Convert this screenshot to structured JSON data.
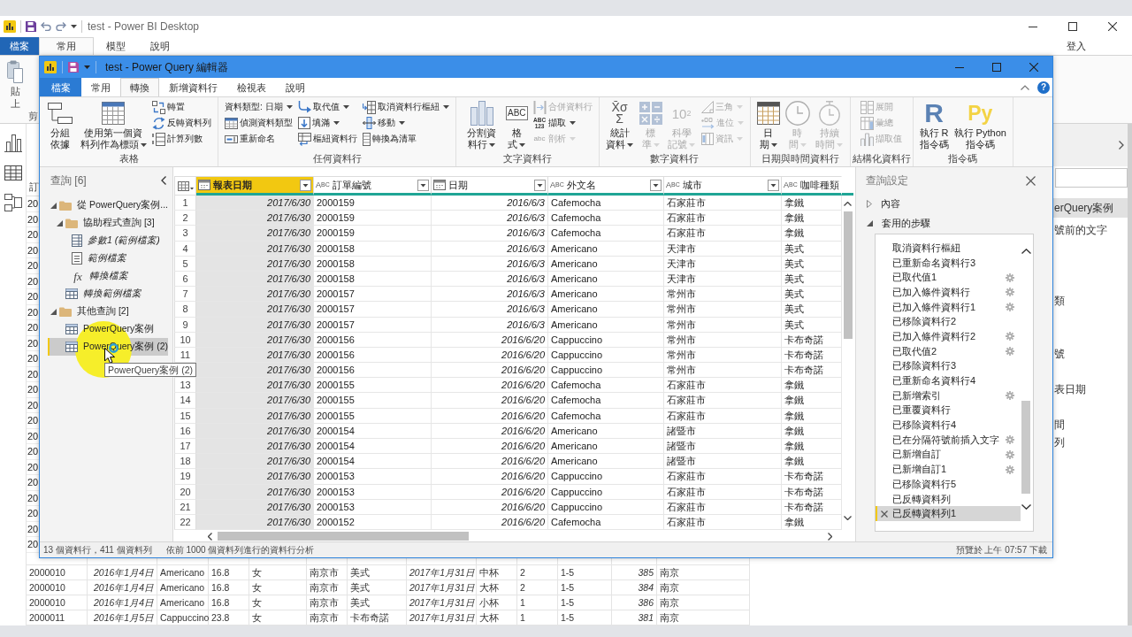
{
  "power_bi": {
    "title": "test - Power BI Desktop",
    "tabs": [
      {
        "label": "檔案",
        "kind": "file",
        "selected": false
      },
      {
        "label": "常用",
        "kind": "tab",
        "selected": true
      },
      {
        "label": "模型",
        "kind": "tab",
        "selected": false
      },
      {
        "label": "說明",
        "kind": "tab",
        "selected": false
      }
    ],
    "sign_in": "登入",
    "ribbon": {
      "paste": "貼上",
      "group_label": "剪"
    },
    "table": {
      "header_cell": "訂",
      "first_column_cells": [
        "20",
        "20",
        "20",
        "20",
        "20",
        "20",
        "20",
        "20",
        "20",
        "20",
        "20",
        "20",
        "20",
        "20",
        "20",
        "20",
        "20",
        "20",
        "20",
        "20",
        "20",
        "20",
        "20"
      ],
      "rows": [
        [
          "2000010",
          "2016年1月4日",
          "Americano",
          "16.8",
          "女",
          "南京市",
          "美式",
          "2017年1月31日",
          "中杯",
          "2",
          "1-5",
          "385",
          "南京"
        ],
        [
          "2000010",
          "2016年1月4日",
          "Americano",
          "16.8",
          "女",
          "南京市",
          "美式",
          "2017年1月31日",
          "大杯",
          "2",
          "1-5",
          "384",
          "南京"
        ],
        [
          "2000010",
          "2016年1月4日",
          "Americano",
          "16.8",
          "女",
          "南京市",
          "美式",
          "2017年1月31日",
          "小杯",
          "1",
          "1-5",
          "386",
          "南京"
        ],
        [
          "2000011",
          "2016年1月5日",
          "Cappuccino",
          "23.8",
          "女",
          "南京市",
          "卡布奇諾",
          "2017年1月31日",
          "大杯",
          "1",
          "1-5",
          "381",
          "南京"
        ]
      ]
    },
    "fields_pane": {
      "items": [
        {
          "label": "erQuery案例",
          "selected": true
        },
        {
          "label": "號前的文字",
          "selected": false
        },
        {
          "label": "類",
          "selected": false
        },
        {
          "label": "號",
          "selected": false
        },
        {
          "label": "表日期",
          "selected": false
        },
        {
          "label": "間",
          "selected": false
        },
        {
          "label": "列",
          "selected": false
        }
      ]
    }
  },
  "query_editor": {
    "title": "test - Power Query 編輯器",
    "tabs": [
      {
        "label": "檔案",
        "kind": "file",
        "selected": false
      },
      {
        "label": "常用",
        "kind": "tab",
        "selected": false
      },
      {
        "label": "轉換",
        "kind": "tab",
        "selected": true
      },
      {
        "label": "新增資料行",
        "kind": "tab",
        "selected": false
      },
      {
        "label": "檢視表",
        "kind": "tab",
        "selected": false
      },
      {
        "label": "說明",
        "kind": "tab",
        "selected": false
      }
    ],
    "help_label": "?",
    "ribbon_groups": [
      {
        "label": "表格",
        "items": [
          {
            "kind": "large",
            "label": "分組依據",
            "dropdown": false,
            "disabled": false
          },
          {
            "kind": "large",
            "label": "使用第一個資料列作為標頭",
            "dropdown": true,
            "disabled": false
          },
          {
            "kind": "small",
            "label": "轉置",
            "dropdown": false,
            "disabled": false
          },
          {
            "kind": "small",
            "label": "反轉資料列",
            "dropdown": false,
            "disabled": false
          },
          {
            "kind": "small",
            "label": "計算列數",
            "dropdown": false,
            "disabled": false
          }
        ]
      },
      {
        "label": "任何資料行",
        "items": [
          {
            "kind": "small",
            "label": "資料類型: 日期",
            "dropdown": true,
            "disabled": false
          },
          {
            "kind": "small",
            "label": "偵測資料類型",
            "dropdown": false,
            "disabled": false
          },
          {
            "kind": "small",
            "label": "重新命名",
            "dropdown": false,
            "disabled": false
          },
          {
            "kind": "small",
            "label": "取代值",
            "dropdown": true,
            "disabled": false
          },
          {
            "kind": "small",
            "label": "填滿",
            "dropdown": true,
            "disabled": false
          },
          {
            "kind": "small",
            "label": "樞紐資料行",
            "dropdown": false,
            "disabled": false
          },
          {
            "kind": "small",
            "label": "取消資料行樞紐",
            "dropdown": true,
            "disabled": false
          },
          {
            "kind": "small",
            "label": "移動",
            "dropdown": true,
            "disabled": false
          },
          {
            "kind": "small",
            "label": "轉換為清單",
            "dropdown": false,
            "disabled": false
          }
        ]
      },
      {
        "label": "文字資料行",
        "items": [
          {
            "kind": "large",
            "label": "分割資料行",
            "dropdown": true,
            "disabled": false
          },
          {
            "kind": "large",
            "label": "格式",
            "icon_text": "ABC",
            "dropdown": true,
            "disabled": false
          },
          {
            "kind": "small",
            "label": "合併資料行",
            "dropdown": false,
            "disabled": true
          },
          {
            "kind": "small",
            "label": "擷取",
            "icon_text": "ABC\n123",
            "dropdown": true,
            "disabled": false
          },
          {
            "kind": "small",
            "label": "剖析",
            "icon_text": "abc",
            "dropdown": true,
            "disabled": true
          }
        ]
      },
      {
        "label": "數字資料行",
        "items": [
          {
            "kind": "large",
            "label": "統計資料",
            "icon_text": "X̄σ\nΣ",
            "dropdown": true,
            "disabled": false
          },
          {
            "kind": "large",
            "label": "標準",
            "dropdown": true,
            "disabled": true
          },
          {
            "kind": "large",
            "label": "科學記號",
            "icon_text": "10$^{2}$",
            "dropdown": true,
            "disabled": true
          },
          {
            "kind": "small",
            "label": "三角",
            "dropdown": true,
            "disabled": true
          },
          {
            "kind": "small",
            "label": "進位",
            "dropdown": true,
            "disabled": true
          },
          {
            "kind": "small",
            "label": "資訊",
            "dropdown": true,
            "disabled": true
          }
        ]
      },
      {
        "label": "日期與時間資料行",
        "items": [
          {
            "kind": "large",
            "label": "日期",
            "dropdown": true,
            "disabled": false
          },
          {
            "kind": "large",
            "label": "時間",
            "dropdown": true,
            "disabled": true
          },
          {
            "kind": "large",
            "label": "持續時間",
            "dropdown": true,
            "disabled": true
          }
        ]
      },
      {
        "label": "結構化資料行",
        "items": [
          {
            "kind": "small",
            "label": "展開",
            "dropdown": false,
            "disabled": true
          },
          {
            "kind": "small",
            "label": "彙總",
            "dropdown": false,
            "disabled": true
          },
          {
            "kind": "small",
            "label": "擷取值",
            "dropdown": false,
            "disabled": true
          }
        ]
      },
      {
        "label": "指令碼",
        "items": [
          {
            "kind": "large",
            "label": "執行 R\n指令碼",
            "icon_text": "R",
            "dropdown": false,
            "disabled": false
          },
          {
            "kind": "large",
            "label": "執行 Python\n指令碼",
            "icon_text": "Py",
            "dropdown": false,
            "disabled": false
          }
        ]
      }
    ],
    "queries": {
      "title": "查詢 [6]",
      "tree": [
        {
          "label": "從 PowerQuery案例...",
          "kind": "folder",
          "expanded": true,
          "selected": false,
          "children": [
            {
              "label": "協助程式查詢 [3]",
              "kind": "folder",
              "expanded": true,
              "selected": false,
              "children": [
                {
                  "label": "參數1 (範例檔案)",
                  "kind": "parameter",
                  "load_enabled": false,
                  "selected": false
                },
                {
                  "label": "範例檔案",
                  "kind": "file",
                  "load_enabled": false,
                  "selected": false
                },
                {
                  "label": "轉換檔案",
                  "kind": "function",
                  "icon_text": "fx",
                  "load_enabled": false,
                  "selected": false
                }
              ]
            },
            {
              "label": "轉換範例檔案",
              "kind": "table",
              "load_enabled": false,
              "selected": false
            }
          ]
        },
        {
          "label": "其他查詢 [2]",
          "kind": "folder",
          "expanded": true,
          "selected": false,
          "children": [
            {
              "label": "PowerQuery案例",
              "kind": "table",
              "load_enabled": true,
              "selected": false
            },
            {
              "label": "PowerQuery案例 (2)",
              "kind": "table",
              "load_enabled": true,
              "selected": true
            }
          ]
        }
      ]
    },
    "grid": {
      "columns": [
        {
          "name": "報表日期",
          "kind": "date",
          "cut_off": false,
          "selected": true
        },
        {
          "name": "訂單編號",
          "kind": "text",
          "type_mark": "A$^{B}$$_{C}$",
          "cut_off": false,
          "selected": false
        },
        {
          "name": "日期",
          "kind": "date",
          "cut_off": false,
          "selected": false
        },
        {
          "name": "外文名",
          "kind": "text",
          "type_mark": "A$^{B}$$_{C}$",
          "cut_off": false,
          "selected": false
        },
        {
          "name": "城市",
          "kind": "text",
          "type_mark": "A$^{B}$$_{C}$",
          "cut_off": false,
          "selected": false
        },
        {
          "name": "咖啡種類",
          "kind": "text",
          "type_mark": "A$^{B}$$_{C}$",
          "cut_off": true,
          "selected": false
        }
      ],
      "rows": [
        {
          "n": "1",
          "cells": [
            "2017/6/30",
            "2000159",
            "2016/6/3",
            "Cafemocha",
            "石家莊市",
            "拿鐵"
          ]
        },
        {
          "n": "2",
          "cells": [
            "2017/6/30",
            "2000159",
            "2016/6/3",
            "Cafemocha",
            "石家莊市",
            "拿鐵"
          ]
        },
        {
          "n": "3",
          "cells": [
            "2017/6/30",
            "2000159",
            "2016/6/3",
            "Cafemocha",
            "石家莊市",
            "拿鐵"
          ]
        },
        {
          "n": "4",
          "cells": [
            "2017/6/30",
            "2000158",
            "2016/6/3",
            "Americano",
            "天津市",
            "美式"
          ]
        },
        {
          "n": "5",
          "cells": [
            "2017/6/30",
            "2000158",
            "2016/6/3",
            "Americano",
            "天津市",
            "美式"
          ]
        },
        {
          "n": "6",
          "cells": [
            "2017/6/30",
            "2000158",
            "2016/6/3",
            "Americano",
            "天津市",
            "美式"
          ]
        },
        {
          "n": "7",
          "cells": [
            "2017/6/30",
            "2000157",
            "2016/6/3",
            "Americano",
            "常州市",
            "美式"
          ]
        },
        {
          "n": "8",
          "cells": [
            "2017/6/30",
            "2000157",
            "2016/6/3",
            "Americano",
            "常州市",
            "美式"
          ]
        },
        {
          "n": "9",
          "cells": [
            "2017/6/30",
            "2000157",
            "2016/6/3",
            "Americano",
            "常州市",
            "美式"
          ]
        },
        {
          "n": "10",
          "cells": [
            "2017/6/30",
            "2000156",
            "2016/6/20",
            "Cappuccino",
            "常州市",
            "卡布奇諾"
          ]
        },
        {
          "n": "11",
          "cells": [
            "2017/6/30",
            "2000156",
            "2016/6/20",
            "Cappuccino",
            "常州市",
            "卡布奇諾"
          ]
        },
        {
          "cells": [
            "2017/6/30",
            "2000156",
            "2016/6/20",
            "Cappuccino",
            "常州市",
            "卡布奇諾"
          ]
        },
        {
          "n": "13",
          "cells": [
            "2017/6/30",
            "2000155",
            "2016/6/20",
            "Cafemocha",
            "石家莊市",
            "拿鐵"
          ]
        },
        {
          "n": "14",
          "cells": [
            "2017/6/30",
            "2000155",
            "2016/6/20",
            "Cafemocha",
            "石家莊市",
            "拿鐵"
          ]
        },
        {
          "n": "15",
          "cells": [
            "2017/6/30",
            "2000155",
            "2016/6/20",
            "Cafemocha",
            "石家莊市",
            "拿鐵"
          ]
        },
        {
          "n": "16",
          "cells": [
            "2017/6/30",
            "2000154",
            "2016/6/20",
            "Americano",
            "諸暨市",
            "拿鐵"
          ]
        },
        {
          "n": "17",
          "cells": [
            "2017/6/30",
            "2000154",
            "2016/6/20",
            "Americano",
            "諸暨市",
            "拿鐵"
          ]
        },
        {
          "n": "18",
          "cells": [
            "2017/6/30",
            "2000154",
            "2016/6/20",
            "Americano",
            "諸暨市",
            "拿鐵"
          ]
        },
        {
          "n": "19",
          "cells": [
            "2017/6/30",
            "2000153",
            "2016/6/20",
            "Cappuccino",
            "石家莊市",
            "卡布奇諾"
          ]
        },
        {
          "n": "20",
          "cells": [
            "2017/6/30",
            "2000153",
            "2016/6/20",
            "Cappuccino",
            "石家莊市",
            "卡布奇諾"
          ]
        },
        {
          "n": "21",
          "cells": [
            "2017/6/30",
            "2000153",
            "2016/6/20",
            "Cappuccino",
            "石家莊市",
            "卡布奇諾"
          ]
        },
        {
          "n": "22",
          "cells": [
            "2017/6/30",
            "2000152",
            "2016/6/20",
            "Cafemocha",
            "石家莊市",
            "拿鐵"
          ]
        }
      ]
    },
    "tooltip": "PowerQuery案例 (2)",
    "query_settings": {
      "title": "查詢設定",
      "sections": [
        {
          "label": "內容",
          "expanded": false
        },
        {
          "label": "套用的步驟",
          "expanded": true,
          "steps": [
            {
              "label": "取消資料行樞紐",
              "has_settings": false,
              "selected": false
            },
            {
              "label": "已重新命名資料行3",
              "has_settings": false,
              "selected": false
            },
            {
              "label": "已取代值1",
              "has_settings": true,
              "selected": false
            },
            {
              "label": "已加入條件資料行",
              "has_settings": true,
              "selected": false
            },
            {
              "label": "已加入條件資料行1",
              "has_settings": true,
              "selected": false
            },
            {
              "label": "已移除資料行2",
              "has_settings": false,
              "selected": false
            },
            {
              "label": "已加入條件資料行2",
              "has_settings": true,
              "selected": false
            },
            {
              "label": "已取代值2",
              "has_settings": true,
              "selected": false
            },
            {
              "label": "已移除資料行3",
              "has_settings": false,
              "selected": false
            },
            {
              "label": "已重新命名資料行4",
              "has_settings": false,
              "selected": false
            },
            {
              "label": "已新增索引",
              "has_settings": true,
              "selected": false
            },
            {
              "label": "已重覆資料行",
              "has_settings": false,
              "selected": false
            },
            {
              "label": "已移除資料行4",
              "has_settings": false,
              "selected": false
            },
            {
              "label": "已在分隔符號前插入文字",
              "has_settings": true,
              "selected": false
            },
            {
              "label": "已新增自訂",
              "has_settings": true,
              "selected": false
            },
            {
              "label": "已新增自訂1",
              "has_settings": true,
              "selected": false
            },
            {
              "label": "已移除資料行5",
              "has_settings": false,
              "selected": false
            },
            {
              "label": "已反轉資料列",
              "has_settings": false,
              "selected": false
            },
            {
              "label": "已反轉資料列1",
              "has_settings": false,
              "selected": true
            }
          ]
        }
      ]
    },
    "status_bar": {
      "columns_info": "13 個資料行，411 個資料列",
      "profiling": "依前 1000 個資料列進行的資料行分析",
      "preview": "預覽於 上午 07:57 下載"
    }
  }
}
